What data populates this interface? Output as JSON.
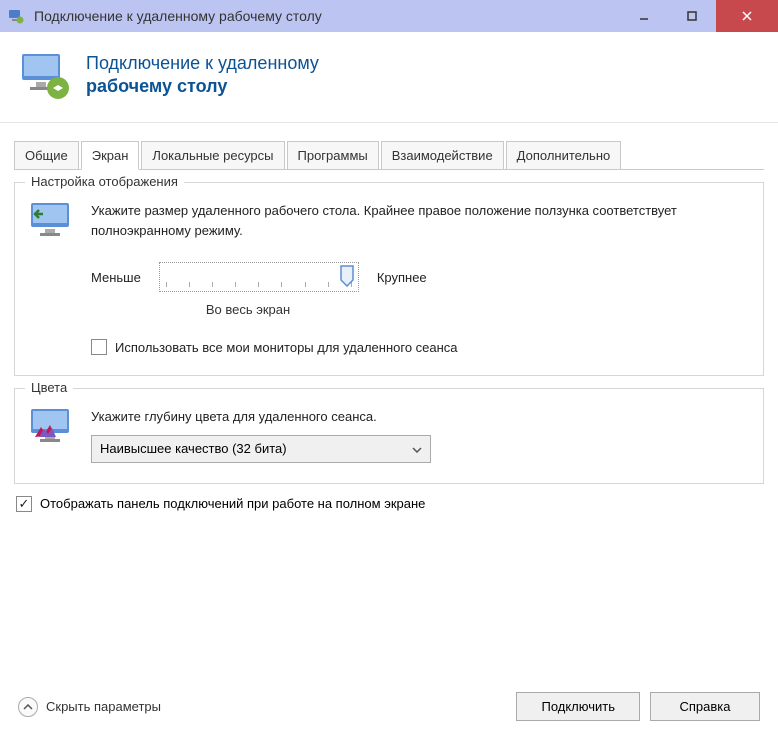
{
  "window": {
    "title": "Подключение к удаленному рабочему столу"
  },
  "header": {
    "line1": "Подключение к удаленному",
    "line2": "рабочему столу"
  },
  "tabs": {
    "general": "Общие",
    "display": "Экран",
    "local": "Локальные ресурсы",
    "programs": "Программы",
    "experience": "Взаимодействие",
    "advanced": "Дополнительно"
  },
  "displayGroup": {
    "legend": "Настройка отображения",
    "description": "Укажите размер удаленного рабочего стола. Крайнее правое положение ползунка соответствует полноэкранному режиму.",
    "sliderMin": "Меньше",
    "sliderMax": "Крупнее",
    "sliderCaption": "Во весь экран",
    "useAllMonitors": "Использовать все мои мониторы для удаленного сеанса"
  },
  "colorsGroup": {
    "legend": "Цвета",
    "description": "Укажите глубину цвета для удаленного сеанса.",
    "selected": "Наивысшее качество (32 бита)"
  },
  "showConnectionBar": "Отображать панель подключений при работе на полном экране",
  "footer": {
    "collapse": "Скрыть параметры",
    "connect": "Подключить",
    "help": "Справка"
  }
}
